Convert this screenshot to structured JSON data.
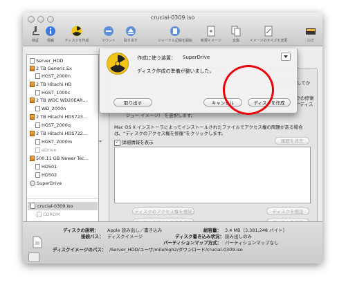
{
  "window": {
    "title": "crucial-0309.iso"
  },
  "toolbar": [
    {
      "label": "検証",
      "icon": "microscope-icon"
    },
    {
      "label": "情報",
      "icon": "info-icon"
    },
    {
      "label": "ディスクを作成",
      "icon": "burn-icon"
    },
    {
      "label": "マウント",
      "icon": "mount-icon"
    },
    {
      "label": "取り出す",
      "icon": "eject-icon"
    },
    {
      "label": "ジャーナル記録を開始",
      "icon": "journal-icon"
    },
    {
      "label": "新規イメージ",
      "icon": "new-image-icon"
    },
    {
      "label": "変換",
      "icon": "convert-icon"
    },
    {
      "label": "イメージのサイズを変更",
      "icon": "resize-image-icon"
    },
    {
      "label": "ログ",
      "icon": "log-icon"
    }
  ],
  "sidebar": {
    "items": [
      {
        "label": "Server_HDD",
        "kind": "volume"
      },
      {
        "label": "2 TB Generic Ex",
        "kind": "drive"
      },
      {
        "label": "HGST_2000n",
        "kind": "volume"
      },
      {
        "label": "2 TB Hitachi HD",
        "kind": "drive"
      },
      {
        "label": "HGST_1000c",
        "kind": "volume"
      },
      {
        "label": "2 TB WDC WD20EAR...",
        "kind": "drive"
      },
      {
        "label": "WD_2000n",
        "kind": "volume"
      },
      {
        "label": "2 TB Hitachi HDS723...",
        "kind": "drive"
      },
      {
        "label": "HGST_2000q",
        "kind": "volume"
      },
      {
        "label": "2 TB Hitachi HDS722...",
        "kind": "drive"
      },
      {
        "label": "HGST_2000m",
        "kind": "volume"
      },
      {
        "label": "eDrive",
        "kind": "volume-dim"
      },
      {
        "label": "500.11 GB Newer Tec...",
        "kind": "drive"
      },
      {
        "label": "HD501",
        "kind": "volume"
      },
      {
        "label": "HD502",
        "kind": "volume"
      },
      {
        "label": "SuperDrive",
        "kind": "superdrive"
      }
    ],
    "image_item": "crucial-0309.iso",
    "cdrom_item": "CDROM"
  },
  "main": {
    "partial_text_1": "バックアップしてか",
    "partial_text_2": "、ディスクの修復",
    "partial_text_3": "リティ”>“ディス",
    "partial_text_4": "ジュー イメージ） を選択します。",
    "description_line1": "Mac OS X インストーラによってインストールされたファイルでアクセス権の問題がある場合",
    "description_line2": "は、“ディスクのアクセス権を修復”をクリックします。",
    "show_details_label": "詳細情報を表示",
    "clear_history_label": "履歴を消去",
    "verify_permissions_label": "ディスクのアクセス権を検証",
    "repair_permissions_label": "ディスクのアクセス権を修復",
    "verify_disk_label": "ディスクを検証",
    "repair_disk_label": "ディスクを修復"
  },
  "info": {
    "description_label": "ディスクの説明：",
    "description_value": "Apple 読み出し／書き込み",
    "connection_label": "接続バス：",
    "connection_value": "ディスクイメージ",
    "capacity_label": "総容量：",
    "capacity_value": "3.4 MB（3,381,248 バイト）",
    "write_status_label": "ディスク書き込み状況：",
    "write_status_value": "読み出しのみ",
    "partition_map_label": "パーティションマップ方式：",
    "partition_map_value": "パーティションマップなし",
    "image_path_label": "ディスクイメージのパス：",
    "image_path_value": "/Server_HDD/ユーザ/milehigh2/ダウンロード/crucial-0309.iso"
  },
  "sheet": {
    "device_label": "作成に使う装置：",
    "device_value": "SuperDrive",
    "status_text": "ディスク作成の準備が整いました。",
    "eject_button": "取り出す",
    "cancel_button": "キャンセル",
    "burn_button": "ディスクを作成"
  },
  "colors": {
    "highlight_circle": "#e8000a",
    "drive_orange": "#e4901f"
  }
}
